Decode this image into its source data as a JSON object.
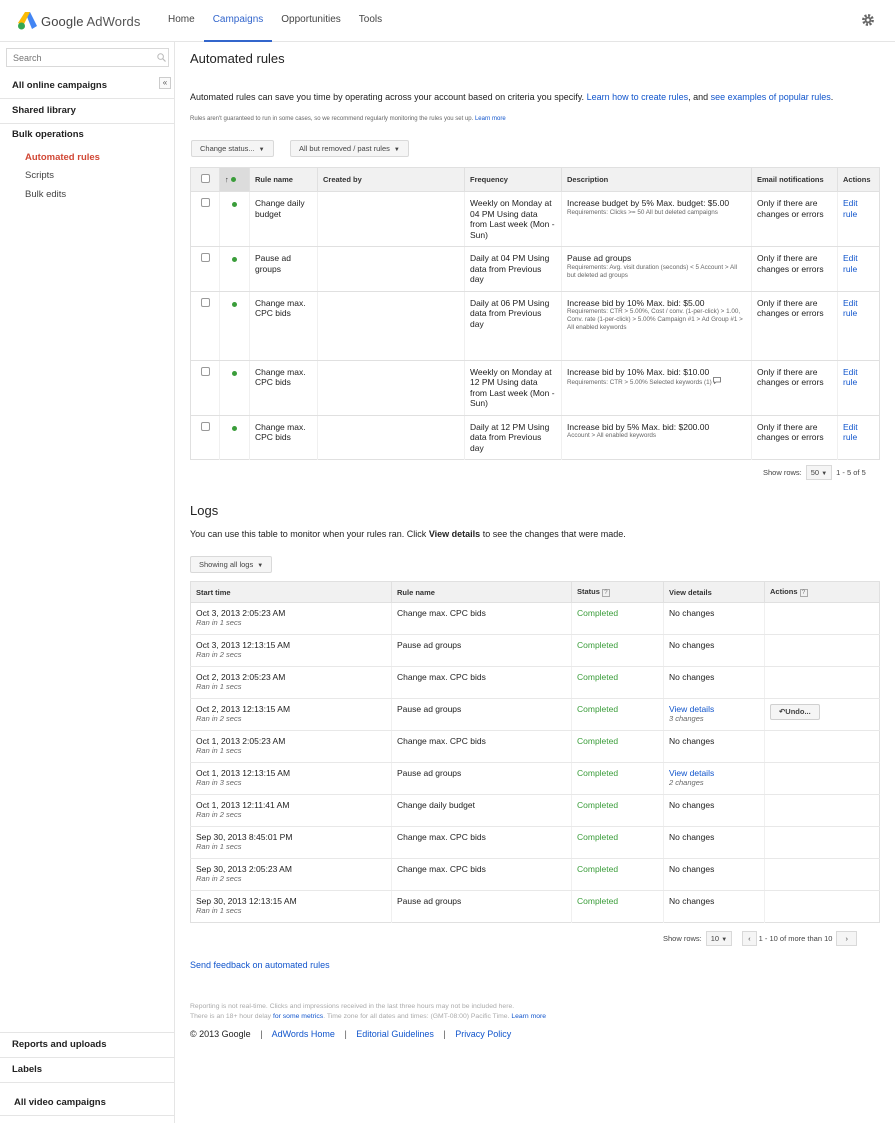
{
  "header": {
    "logo_google": "Google",
    "logo_product": "AdWords",
    "nav": [
      "Home",
      "Campaigns",
      "Opportunities",
      "Tools"
    ],
    "active_nav": "Campaigns",
    "accent_color": "#3366cc"
  },
  "sidebar": {
    "search_placeholder": "Search",
    "collapse_glyph": "«",
    "all_online_campaigns": "All online campaigns",
    "shared_library": "Shared library",
    "bulk_operations": "Bulk operations",
    "bulk_items": [
      "Automated rules",
      "Scripts",
      "Bulk edits"
    ],
    "reports_and_uploads": "Reports and uploads",
    "labels": "Labels",
    "all_video_campaigns": "All video campaigns",
    "active_color": "#d14836"
  },
  "rules": {
    "title": "Automated rules",
    "intro_text": "Automated rules can save you time by operating across your account based on criteria you specify.",
    "intro_link1": "Learn how to create rules",
    "intro_and": ", and",
    "intro_link2": "see examples of popular rules",
    "intro_period": ".",
    "disclaimer": "Rules aren't guaranteed to run in some cases, so we recommend regularly monitoring the rules you set up.",
    "disclaimer_link": "Learn more",
    "change_status_button": "Change status...",
    "filter_button": "All but removed / past rules",
    "columns": {
      "sort": "↑",
      "rule_name": "Rule name",
      "created_by": "Created by",
      "frequency": "Frequency",
      "description": "Description",
      "email": "Email notifications",
      "actions": "Actions"
    },
    "rows": [
      {
        "name": "Change daily budget",
        "created_by": "",
        "frequency": "Weekly on Monday at 04 PM Using data from Last week (Mon - Sun)",
        "desc_main": "Increase budget by 5% Max. budget: $5.00",
        "desc_small": "Requirements: Clicks >= 50 All but deleted campaigns",
        "email": "Only if there are changes or errors",
        "action": "Edit rule"
      },
      {
        "name": "Pause ad groups",
        "created_by": "",
        "frequency": "Daily at 04 PM Using data from Previous day",
        "desc_main": "Pause ad groups",
        "desc_small": "Requirements: Avg. visit duration (seconds) < 5 Account > All but deleted ad groups",
        "email": "Only if there are changes or errors",
        "action": "Edit rule"
      },
      {
        "name": "Change max. CPC bids",
        "created_by": "",
        "frequency": "Daily at 06 PM Using data from Previous day",
        "desc_main": "Increase bid by 10% Max. bid: $5.00",
        "desc_small": "Requirements: CTR > 5.00%, Cost / conv. (1-per-click) > 1.00, Conv. rate (1-per-click) > 5.00% Campaign #1 > Ad Group #1 > All enabled keywords",
        "email": "Only if there are changes or errors",
        "action": "Edit rule"
      },
      {
        "name": "Change max. CPC bids",
        "created_by": "",
        "frequency": "Weekly on Monday at 12 PM Using data from Last week (Mon - Sun)",
        "desc_main": "Increase bid by 10% Max. bid: $10.00",
        "desc_small": "Requirements: CTR > 5.00% Selected keywords (1)",
        "email": "Only if there are changes or errors",
        "action": "Edit rule"
      },
      {
        "name": "Change max. CPC bids",
        "created_by": "",
        "frequency": "Daily at 12 PM Using data from Previous day",
        "desc_main": "Increase bid by 5% Max. bid: $200.00",
        "desc_small": "Account > All enabled keywords",
        "email": "Only if there are changes or errors",
        "action": "Edit rule"
      }
    ],
    "show_rows_label": "Show rows:",
    "show_rows_value": "50",
    "range": "1 - 5 of 5",
    "status_color": "#3a9d3a"
  },
  "logs": {
    "title": "Logs",
    "intro_before": "You can use this table to monitor when your rules ran. Click",
    "intro_bold": "View details",
    "intro_after": "to see the changes that were made.",
    "filter_button": "Showing all logs",
    "columns": {
      "start_time": "Start time",
      "rule_name": "Rule name",
      "status": "Status",
      "view_details": "View details",
      "actions": "Actions",
      "help_glyph": "?"
    },
    "rows": [
      {
        "time": "Oct 3, 2013 2:05:23 AM",
        "ran": "Ran in 1 secs",
        "rule": "Change max. CPC bids",
        "status": "Completed",
        "details": "No changes",
        "details_sub": "",
        "action": ""
      },
      {
        "time": "Oct 3, 2013 12:13:15 AM",
        "ran": "Ran in 2 secs",
        "rule": "Pause ad groups",
        "status": "Completed",
        "details": "No changes",
        "details_sub": "",
        "action": ""
      },
      {
        "time": "Oct 2, 2013 2:05:23 AM",
        "ran": "Ran in 1 secs",
        "rule": "Change max. CPC bids",
        "status": "Completed",
        "details": "No changes",
        "details_sub": "",
        "action": ""
      },
      {
        "time": "Oct 2, 2013 12:13:15 AM",
        "ran": "Ran in 2 secs",
        "rule": "Pause ad groups",
        "status": "Completed",
        "details": "View details",
        "details_sub": "3 changes",
        "action": "Undo..."
      },
      {
        "time": "Oct 1, 2013 2:05:23 AM",
        "ran": "Ran in 1 secs",
        "rule": "Change max. CPC bids",
        "status": "Completed",
        "details": "No changes",
        "details_sub": "",
        "action": ""
      },
      {
        "time": "Oct 1, 2013 12:13:15 AM",
        "ran": "Ran in 3 secs",
        "rule": "Pause ad groups",
        "status": "Completed",
        "details": "View details",
        "details_sub": "2 changes",
        "action": ""
      },
      {
        "time": "Oct 1, 2013 12:11:41 AM",
        "ran": "Ran in 2 secs",
        "rule": "Change daily budget",
        "status": "Completed",
        "details": "No changes",
        "details_sub": "",
        "action": ""
      },
      {
        "time": "Sep 30, 2013 8:45:01 PM",
        "ran": "Ran in 1 secs",
        "rule": "Change max. CPC bids",
        "status": "Completed",
        "details": "No changes",
        "details_sub": "",
        "action": ""
      },
      {
        "time": "Sep 30, 2013 2:05:23 AM",
        "ran": "Ran in 2 secs",
        "rule": "Change max. CPC bids",
        "status": "Completed",
        "details": "No changes",
        "details_sub": "",
        "action": ""
      },
      {
        "time": "Sep 30, 2013 12:13:15 AM",
        "ran": "Ran in 1 secs",
        "rule": "Pause ad groups",
        "status": "Completed",
        "details": "No changes",
        "details_sub": "",
        "action": ""
      }
    ],
    "show_rows_label": "Show rows:",
    "show_rows_value": "10",
    "range": "1 - 10 of more than 10",
    "prev_glyph": "‹",
    "next_glyph": "›"
  },
  "footer": {
    "feedback_link": "Send feedback on automated rules",
    "note_line1": "Reporting is not real-time. Clicks and impressions received in the last three hours may not be included here.",
    "note_line2_a": "There is an 18+ hour delay",
    "note_line2_link": "for some metrics",
    "note_line2_b": ". Time zone for all dates and times: (GMT-08:00) Pacific Time.",
    "note_learn_more": "Learn more",
    "copyright": "© 2013 Google",
    "sep": "|",
    "links": [
      "AdWords Home",
      "Editorial Guidelines",
      "Privacy Policy"
    ]
  }
}
